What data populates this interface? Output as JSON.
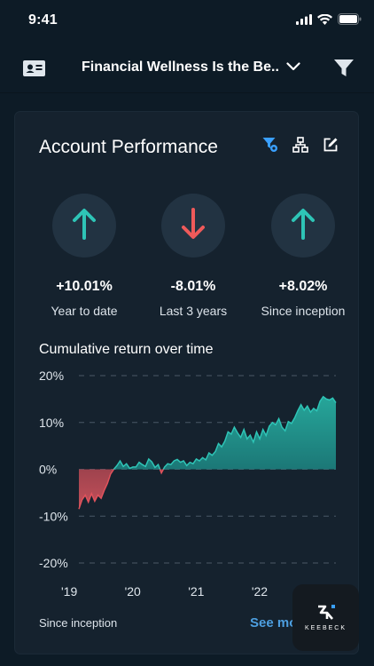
{
  "status_bar": {
    "time": "9:41"
  },
  "nav": {
    "title": "Financial Wellness Is the Be..",
    "left_icon": "contact-card-icon",
    "right_icon": "filter-icon"
  },
  "card": {
    "title": "Account Performance",
    "tools": [
      "filter-settings-icon",
      "hierarchy-icon",
      "edit-icon"
    ],
    "metrics": [
      {
        "value": "+10.01%",
        "label": "Year to date",
        "direction": "up",
        "color": "#2ec4b6"
      },
      {
        "value": "-8.01%",
        "label": "Last 3 years",
        "direction": "down",
        "color": "#ef5a5a"
      },
      {
        "value": "+8.02%",
        "label": "Since inception",
        "direction": "up",
        "color": "#2ec4b6"
      }
    ],
    "chart_title": "Cumulative return over time",
    "footer_left": "Since inception",
    "footer_right": "See mo"
  },
  "chart_data": {
    "type": "area",
    "title": "Cumulative return over time",
    "xlabel": "",
    "ylabel": "",
    "ylim": [
      -20,
      20
    ],
    "ytick_labels": [
      "20%",
      "10%",
      "0%",
      "-10%",
      "-20%"
    ],
    "xtick_labels": [
      "'19",
      "'20",
      "'21",
      "'22"
    ],
    "grid": "horizontal dashed",
    "positive_color": "#1f8f87",
    "negative_color": "#b84a55",
    "series": [
      {
        "x": [
          2019.0,
          2019.05,
          2019.1,
          2019.15,
          2019.2,
          2019.25,
          2019.3,
          2019.35,
          2019.4,
          2019.45,
          2019.5,
          2019.55,
          2019.6,
          2019.65,
          2019.7,
          2019.75,
          2019.8,
          2019.85,
          2019.9,
          2019.95,
          2020.0,
          2020.05,
          2020.1,
          2020.15,
          2020.2,
          2020.25,
          2020.3,
          2020.35,
          2020.4,
          2020.45,
          2020.5,
          2020.55,
          2020.6,
          2020.65,
          2020.7,
          2020.75,
          2020.8,
          2020.85,
          2020.9,
          2020.95,
          2021.0,
          2021.05,
          2021.1,
          2021.15,
          2021.2,
          2021.25,
          2021.3,
          2021.35,
          2021.4,
          2021.45,
          2021.5,
          2021.55,
          2021.6,
          2021.65,
          2021.7,
          2021.75,
          2021.8,
          2021.85,
          2021.9,
          2021.95,
          2022.0,
          2022.05,
          2022.1,
          2022.15,
          2022.2,
          2022.25,
          2022.3,
          2022.35,
          2022.4,
          2022.45,
          2022.5,
          2022.55,
          2022.6,
          2022.65,
          2022.7,
          2022.75,
          2022.8,
          2022.85,
          2022.9,
          2022.95,
          2023.0,
          2023.05
        ],
        "values": [
          -8.5,
          -6.5,
          -5.5,
          -7,
          -5.2,
          -6.8,
          -5.5,
          -6.2,
          -4.5,
          -3,
          -1,
          0,
          0.8,
          1.8,
          0.6,
          1.2,
          0.2,
          0.5,
          0.5,
          1.5,
          1,
          0.6,
          2.2,
          1.6,
          0.4,
          1,
          -0.8,
          0.5,
          1.2,
          1,
          1.8,
          2.1,
          1.5,
          1.8,
          0.8,
          1.5,
          1.2,
          2.2,
          1.8,
          2.5,
          2,
          3.5,
          3,
          3.8,
          5.5,
          4.8,
          6,
          8,
          7.5,
          9,
          7.8,
          6.8,
          8.5,
          6.5,
          7.3,
          5.8,
          8,
          6.5,
          8.5,
          7.2,
          9.2,
          10,
          9.5,
          10.8,
          9,
          8.2,
          10.2,
          9.8,
          11,
          12.5,
          13.8,
          12.6,
          13.5,
          12.2,
          13,
          12.5,
          14.5,
          15.5,
          15,
          14.8,
          15.2,
          14.2
        ]
      }
    ]
  }
}
